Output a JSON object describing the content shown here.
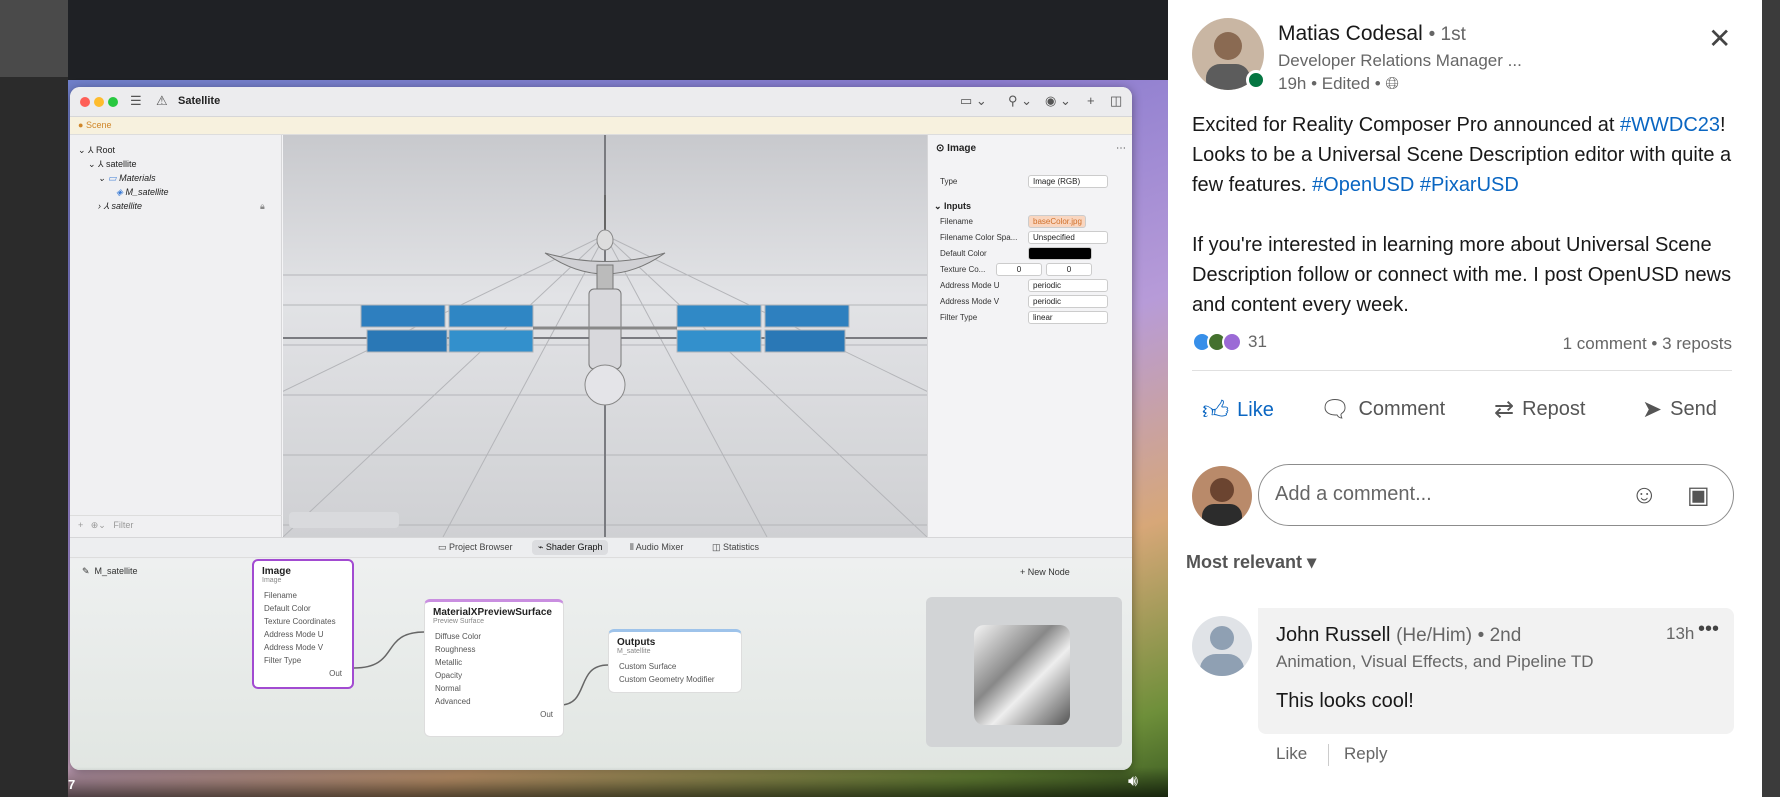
{
  "video": {
    "window_title": "Satellite",
    "scene_tab": "Scene",
    "hierarchy": [
      {
        "label": "Root"
      },
      {
        "label": "satellite"
      },
      {
        "label": "Materials"
      },
      {
        "label": "M_satellite"
      },
      {
        "label": "satellite"
      }
    ],
    "filter_placeholder": "Filter",
    "inspector": {
      "header": "Image",
      "type_label": "Type",
      "type_value": "Image (RGB)",
      "inputs_header": "Inputs",
      "rows": [
        {
          "label": "Filename",
          "value": "baseColor.jpg"
        },
        {
          "label": "Filename Color Spa...",
          "value": "Unspecified"
        },
        {
          "label": "Default Color",
          "value": ""
        },
        {
          "label": "Texture Co...",
          "value": "0",
          "value2": "0"
        },
        {
          "label": "Address Mode U",
          "value": "periodic"
        },
        {
          "label": "Address Mode V",
          "value": "periodic"
        },
        {
          "label": "Filter Type",
          "value": "linear"
        }
      ]
    },
    "bottom_tabs": [
      "Project Browser",
      "Shader Graph",
      "Audio Mixer",
      "Statistics"
    ],
    "graph_title": "M_satellite",
    "new_node": "New Node",
    "nodes": {
      "image": {
        "title": "Image",
        "subtitle": "Image",
        "ports": [
          "Filename",
          "Default Color",
          "Texture Coordinates",
          "Address Mode U",
          "Address Mode V",
          "Filter Type"
        ],
        "out": "Out"
      },
      "preview": {
        "title": "MaterialXPreviewSurface",
        "subtitle": "Preview Surface",
        "ports": [
          "Diffuse Color",
          "Roughness",
          "Metallic",
          "Opacity",
          "Normal",
          "Advanced"
        ],
        "out": "Out"
      },
      "outputs": {
        "title": "Outputs",
        "subtitle": "M_satellite",
        "ports": [
          "Custom Surface",
          "Custom Geometry Modifier"
        ]
      }
    },
    "time_fragment": "7"
  },
  "post": {
    "author": "Matias Codesal",
    "degree": "• 1st",
    "headline": "Developer Relations Manager ...",
    "meta": "19h • Edited •",
    "text_parts": [
      "Excited for Reality Composer Pro announced at ",
      "#WWDC23",
      "! Looks to be a Universal Scene Description editor with quite a few features. ",
      "#OpenUSD",
      " ",
      "#PixarUSD"
    ],
    "text2": "If you're interested in learning more about Universal Scene Description follow or connect with me. I post OpenUSD news and content every week.",
    "reactions": "31",
    "counts": "1 comment • 3 reposts",
    "actions": [
      "Like",
      "Comment",
      "Repost",
      "Send"
    ],
    "comment_placeholder": "Add a comment...",
    "sort": "Most relevant",
    "comment": {
      "author": "John Russell",
      "pronoun": "(He/Him)",
      "degree": "• 2nd",
      "headline": "Animation, Visual Effects, and Pipeline TD",
      "time": "13h",
      "text": "This looks cool!",
      "like": "Like",
      "reply": "Reply"
    }
  },
  "colors": {
    "link": "#0a66c2",
    "online": "#057642"
  }
}
